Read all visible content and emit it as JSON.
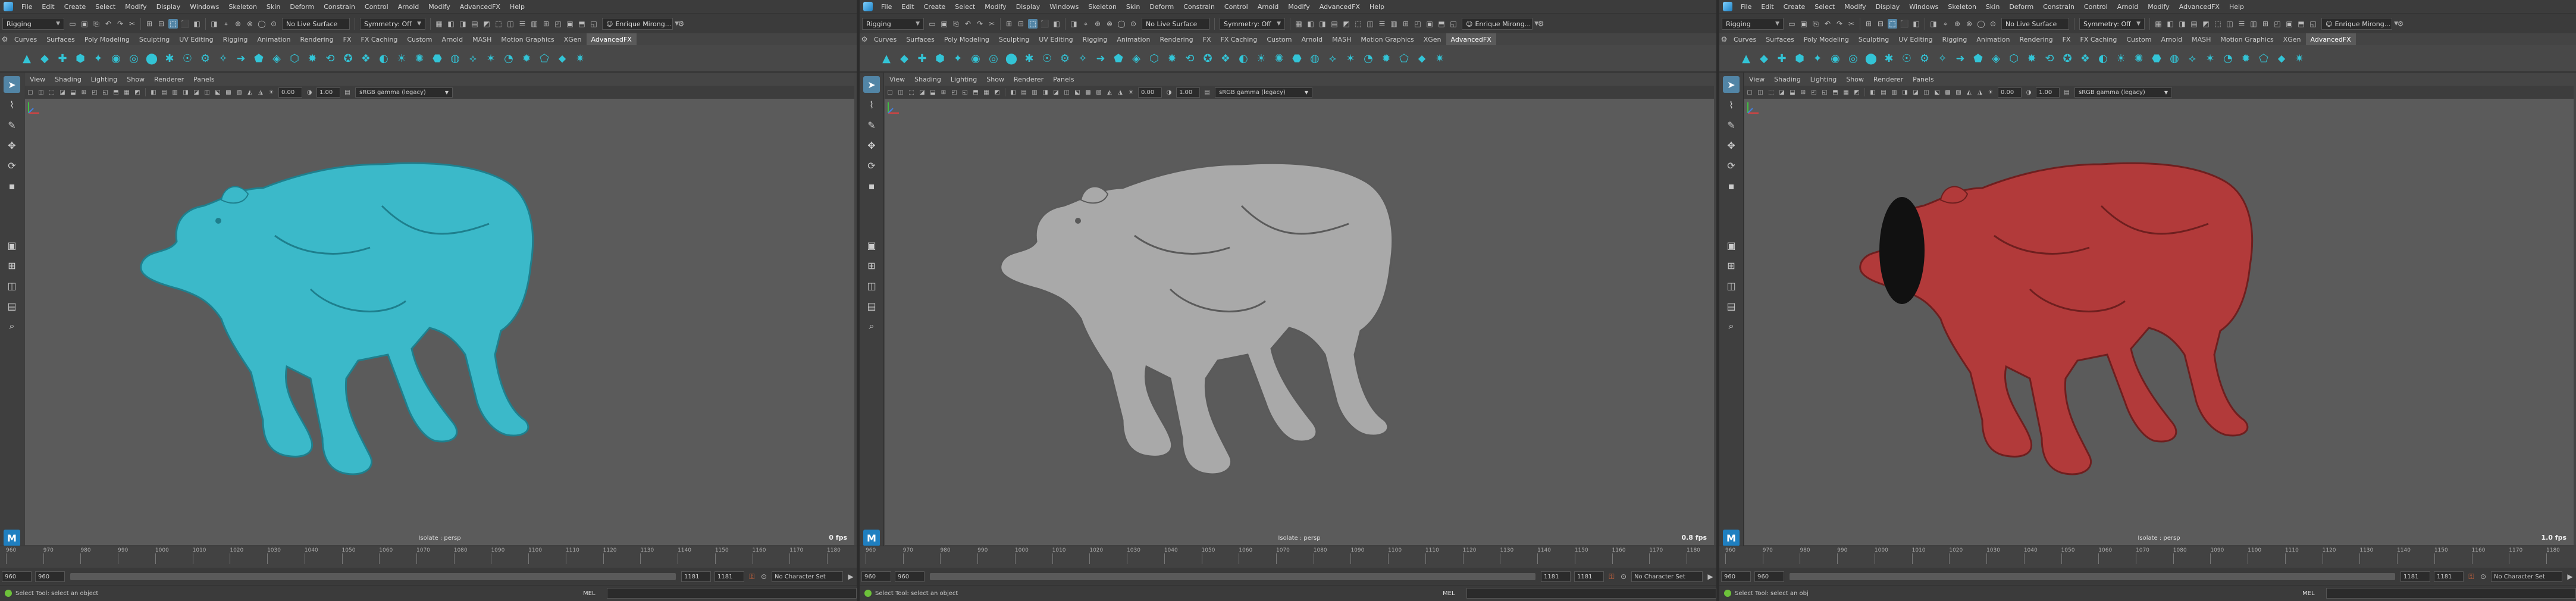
{
  "panes": [
    {
      "menubar": [
        "File",
        "Edit",
        "Create",
        "Select",
        "Modify",
        "Display",
        "Windows",
        "Skeleton",
        "Skin",
        "Deform",
        "Constrain",
        "Control",
        "Arnold",
        "Modify",
        "AdvancedFX",
        "Help"
      ],
      "workspace": "Rigging",
      "live_surface": "No Live Surface",
      "symmetry": "Symmetry: Off",
      "user": "Enrique Mirong...",
      "shelf_tabs": [
        "Curves",
        "Surfaces",
        "Poly Modeling",
        "Sculpting",
        "UV Editing",
        "Rigging",
        "Animation",
        "Rendering",
        "FX",
        "FX Caching",
        "Custom",
        "Arnold",
        "MASH",
        "Motion Graphics",
        "XGen",
        "AdvancedFX"
      ],
      "active_tab": "AdvancedFX",
      "viewport_menu": [
        "View",
        "Shading",
        "Lighting",
        "Show",
        "Renderer",
        "Panels"
      ],
      "exposure": "0.00",
      "gamma": "1.00",
      "color_space": "sRGB gamma (legacy)",
      "camera_label": "Isolate : persp",
      "fps": "0 fps",
      "model_color": "#3bb9c9",
      "model_shadow": "#1e7f8d",
      "timeline_ticks": [
        "960",
        "970",
        "980",
        "990",
        "1000",
        "1010",
        "1020",
        "1030",
        "1040",
        "1050",
        "1060",
        "1070",
        "1080",
        "1090",
        "1100",
        "1110",
        "1120",
        "1130",
        "1140",
        "1150",
        "1160",
        "1170",
        "1180"
      ],
      "range_start": "960",
      "range_start_inner": "960",
      "range_end_inner": "1181",
      "range_end": "1181",
      "character_set": "No Character Set",
      "help_text": "Select Tool: select an object",
      "mel_label": "MEL"
    },
    {
      "menubar": [
        "File",
        "Edit",
        "Create",
        "Select",
        "Modify",
        "Display",
        "Windows",
        "Skeleton",
        "Skin",
        "Deform",
        "Constrain",
        "Control",
        "Arnold",
        "Modify",
        "AdvancedFX",
        "Help"
      ],
      "workspace": "Rigging",
      "live_surface": "No Live Surface",
      "symmetry": "Symmetry: Off",
      "user": "Enrique Mirong...",
      "shelf_tabs": [
        "Curves",
        "Surfaces",
        "Poly Modeling",
        "Sculpting",
        "UV Editing",
        "Rigging",
        "Animation",
        "Rendering",
        "FX",
        "FX Caching",
        "Custom",
        "Arnold",
        "MASH",
        "Motion Graphics",
        "XGen",
        "AdvancedFX"
      ],
      "active_tab": "AdvancedFX",
      "viewport_menu": [
        "View",
        "Shading",
        "Lighting",
        "Show",
        "Renderer",
        "Panels"
      ],
      "exposure": "0.00",
      "gamma": "1.00",
      "color_space": "sRGB gamma (legacy)",
      "camera_label": "Isolate : persp",
      "fps": "0.8 fps",
      "model_color": "#a9a9a9",
      "model_shadow": "#5a5a5a",
      "timeline_ticks": [
        "960",
        "970",
        "980",
        "990",
        "1000",
        "1010",
        "1020",
        "1030",
        "1040",
        "1050",
        "1060",
        "1070",
        "1080",
        "1090",
        "1100",
        "1110",
        "1120",
        "1130",
        "1140",
        "1150",
        "1160",
        "1170",
        "1180"
      ],
      "range_start": "960",
      "range_start_inner": "960",
      "range_end_inner": "1181",
      "range_end": "1181",
      "character_set": "No Character Set",
      "help_text": "Select Tool: select an object",
      "mel_label": "MEL"
    },
    {
      "menubar": [
        "File",
        "Edit",
        "Create",
        "Select",
        "Modify",
        "Display",
        "Windows",
        "Skeleton",
        "Skin",
        "Deform",
        "Constrain",
        "Control",
        "Arnold",
        "Modify",
        "AdvancedFX",
        "Help"
      ],
      "workspace": "Rigging",
      "live_surface": "No Live Surface",
      "symmetry": "Symmetry: Off",
      "user": "Enrique Mirong...",
      "shelf_tabs": [
        "Curves",
        "Surfaces",
        "Poly Modeling",
        "Sculpting",
        "UV Editing",
        "Rigging",
        "Animation",
        "Rendering",
        "FX",
        "FX Caching",
        "Custom",
        "Arnold",
        "MASH",
        "Motion Graphics",
        "XGen",
        "AdvancedFX"
      ],
      "active_tab": "AdvancedFX",
      "viewport_menu": [
        "View",
        "Shading",
        "Lighting",
        "Show",
        "Renderer",
        "Panels"
      ],
      "exposure": "0.00",
      "gamma": "1.00",
      "color_space": "sRGB gamma (legacy)",
      "camera_label": "Isolate : persp",
      "fps": "1.0 fps",
      "model_color": "#b23a3a",
      "model_shadow": "#6e1f1f",
      "timeline_ticks": [
        "960",
        "970",
        "980",
        "990",
        "1000",
        "1010",
        "1020",
        "1030",
        "1040",
        "1050",
        "1060",
        "1070",
        "1080",
        "1090",
        "1100",
        "1110",
        "1120",
        "1130",
        "1140",
        "1150",
        "1160",
        "1170",
        "1180"
      ],
      "range_start": "960",
      "range_start_inner": "960",
      "range_end_inner": "1181",
      "range_end": "1181",
      "character_set": "No Character Set",
      "help_text": "Select Tool: select an obj",
      "mel_label": "MEL"
    }
  ]
}
